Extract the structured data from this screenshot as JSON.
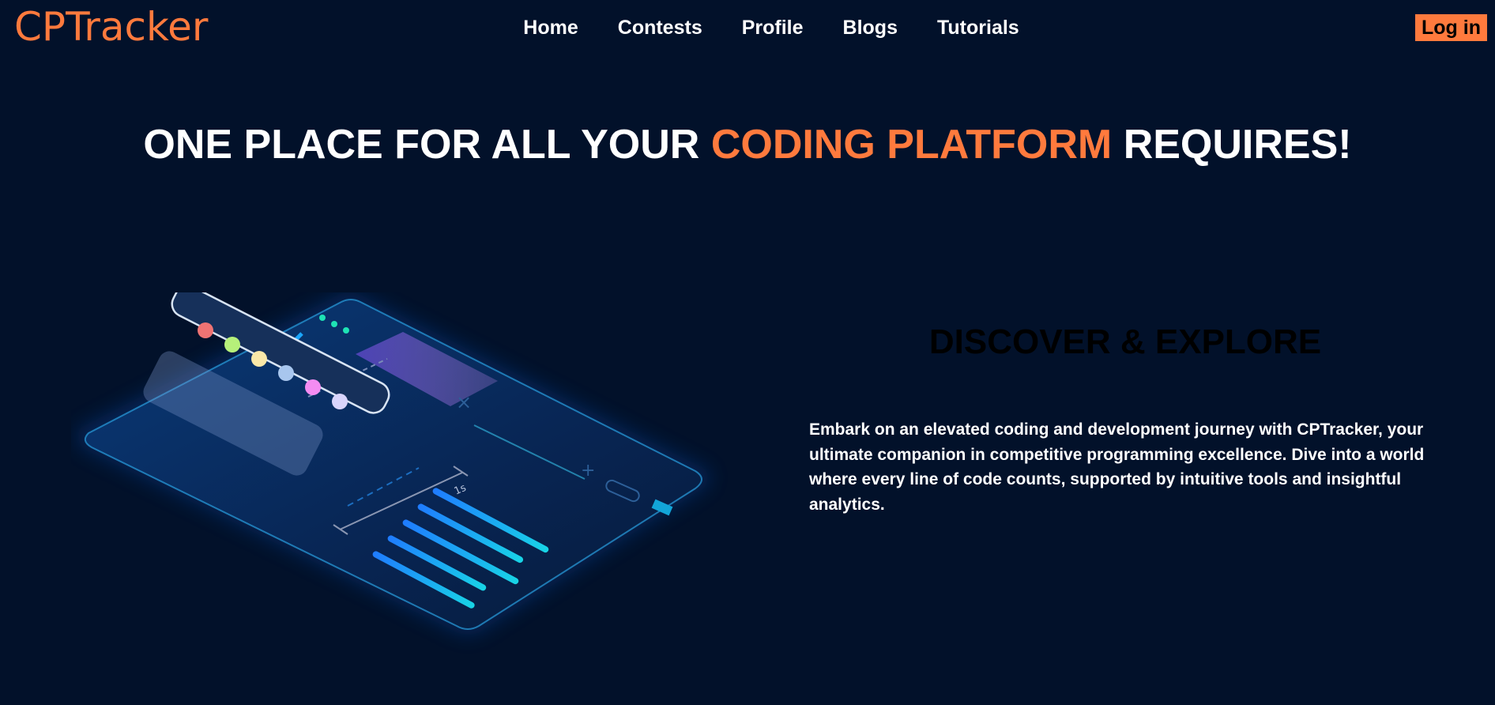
{
  "brand": {
    "logo_text": "CPTracker"
  },
  "nav": {
    "items": [
      {
        "label": "Home"
      },
      {
        "label": "Contests"
      },
      {
        "label": "Profile"
      },
      {
        "label": "Blogs"
      },
      {
        "label": "Tutorials"
      }
    ],
    "login_label": "Log in"
  },
  "hero": {
    "title_part1": "ONE PLACE FOR ALL YOUR ",
    "title_accent": "CODING PLATFORM",
    "title_part2": " REQUIRES!"
  },
  "section": {
    "title": "DISCOVER & EXPLORE",
    "body": "Embark on an elevated coding and development journey with CPTracker, your ultimate companion in competitive programming excellence. Dive into a world where every line of code counts, supported by intuitive tools and insightful analytics."
  },
  "illustration": {
    "label": "1s"
  },
  "colors": {
    "background": "#02112a",
    "accent": "#ff7a3d",
    "text": "#ffffff"
  }
}
